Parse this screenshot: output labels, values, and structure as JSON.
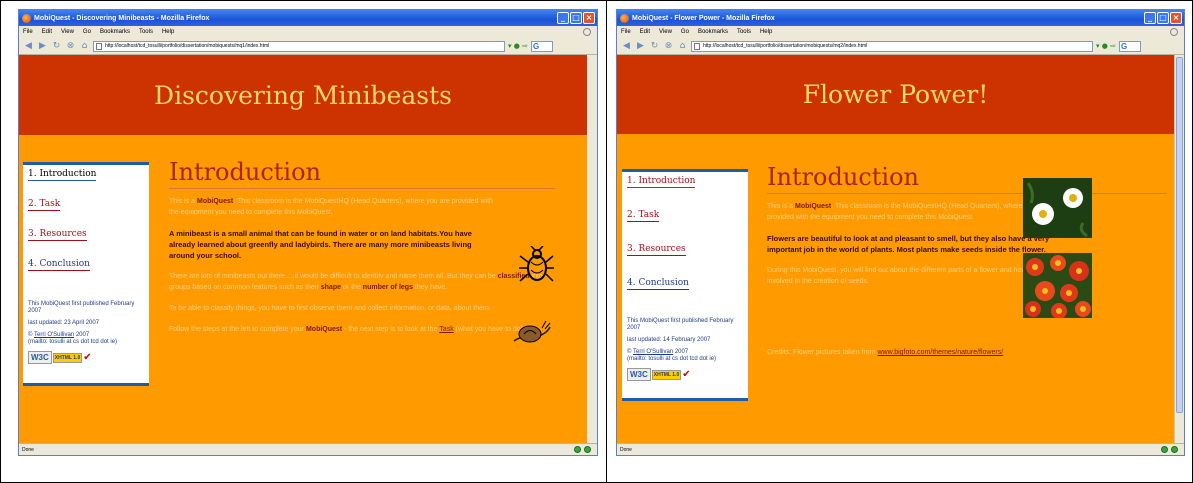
{
  "windows": [
    {
      "window_title": "MobiQuest - Discovering Minibeasts - Mozilla Firefox",
      "menu": [
        "File",
        "Edit",
        "View",
        "Go",
        "Bookmarks",
        "Tools",
        "Help"
      ],
      "url": "http://localhost/tcd_tosulli/portfolio/dissertation/mobiquests/mq1/index.html",
      "search_placeholder": "G",
      "banner_title": "Discovering Minibeasts",
      "nav": [
        {
          "label": "1. Introduction"
        },
        {
          "label": "2. Task"
        },
        {
          "label": "3. Resources"
        },
        {
          "label": "4. Conclusion"
        }
      ],
      "meta": {
        "published": "This MobiQuest first published February 2007",
        "updated": "last updated: 23 April 2007",
        "copyright_prefix": "© ",
        "author": "Terri O'Sullivan",
        "copyright_suffix": " 2007",
        "mail": "(mailto: tosulli at cs dot tcd dot ie)"
      },
      "w3c": {
        "w3": "W3C",
        "xhtml": "XHTML 1.0"
      },
      "heading": "Introduction",
      "p1_a": "This is a ",
      "p1_b": "MobiQuest",
      "p1_c": ". This classroom is the MobiQuestHQ (Head Quarters), where you are provided with the equipment you need to complete this MobiQuest.",
      "p2": "A minibeast is a small animal that can be found in water or on land habitats.You have already learned about greenfly and ladybirds. There are many more minibeasts living around your school.",
      "p3_a": "There are lots of minibeasts out there.....it would be difficult to identify and name them all. But they can be ",
      "p3_b": "classified",
      "p3_c": " into groups based on common features such as their ",
      "p3_d": "shape",
      "p3_e": " or the ",
      "p3_f": "number of legs",
      "p3_g": " they have.",
      "p4": "To be able to classify things, you have to first observe them and collect information, or data, about them.",
      "p5_a": "Follow the steps at the left to complete your ",
      "p5_b": "MobiQuest",
      "p5_c": " - the next step is to look at the ",
      "p5_link": "Task",
      "p5_d": " (what you have to do).",
      "status": "Done"
    },
    {
      "window_title": "MobiQuest - Flower Power - Mozilla Firefox",
      "menu": [
        "File",
        "Edit",
        "View",
        "Go",
        "Bookmarks",
        "Tools",
        "Help"
      ],
      "url": "http://localhost/tcd_tosulli/portfolio/dissertation/mobiquests/mq2/index.html",
      "search_placeholder": "G",
      "banner_title": "Flower Power!",
      "nav": [
        {
          "label": "1. Introduction"
        },
        {
          "label": "2. Task"
        },
        {
          "label": "3. Resources"
        },
        {
          "label": "4. Conclusion"
        }
      ],
      "meta": {
        "published": "This MobiQuest first published February 2007",
        "updated": "last updated: 14 February 2007",
        "copyright_prefix": "© ",
        "author": "Terri O'Sullivan",
        "copyright_suffix": " 2007",
        "mail": "(mailto: tosulli at cs dot tcd dot ie)"
      },
      "w3c": {
        "w3": "W3C",
        "xhtml": "XHTML 1.0"
      },
      "heading": "Introduction",
      "p1_a": "This is a ",
      "p1_b": "MobiQuest",
      "p1_c": ". This classroom is the MobiQuestHQ (Head Quarters), where you are provided with the equipment you need to complete this MobiQuest.",
      "p2": "Flowers are beautiful to look at and pleasant to smell, but they also have a very important job in the world of plants. Most plants make seeds inside the flower.",
      "p3": "During this MobiQuest, you will find out about the different parts of a flower and how they are involved in the creation of seeds.",
      "credits_a": "Credits: Flower pictures taken from ",
      "credits_link": "www.bigfoto.com/themes/nature/flowers/",
      "status": "Done"
    }
  ]
}
